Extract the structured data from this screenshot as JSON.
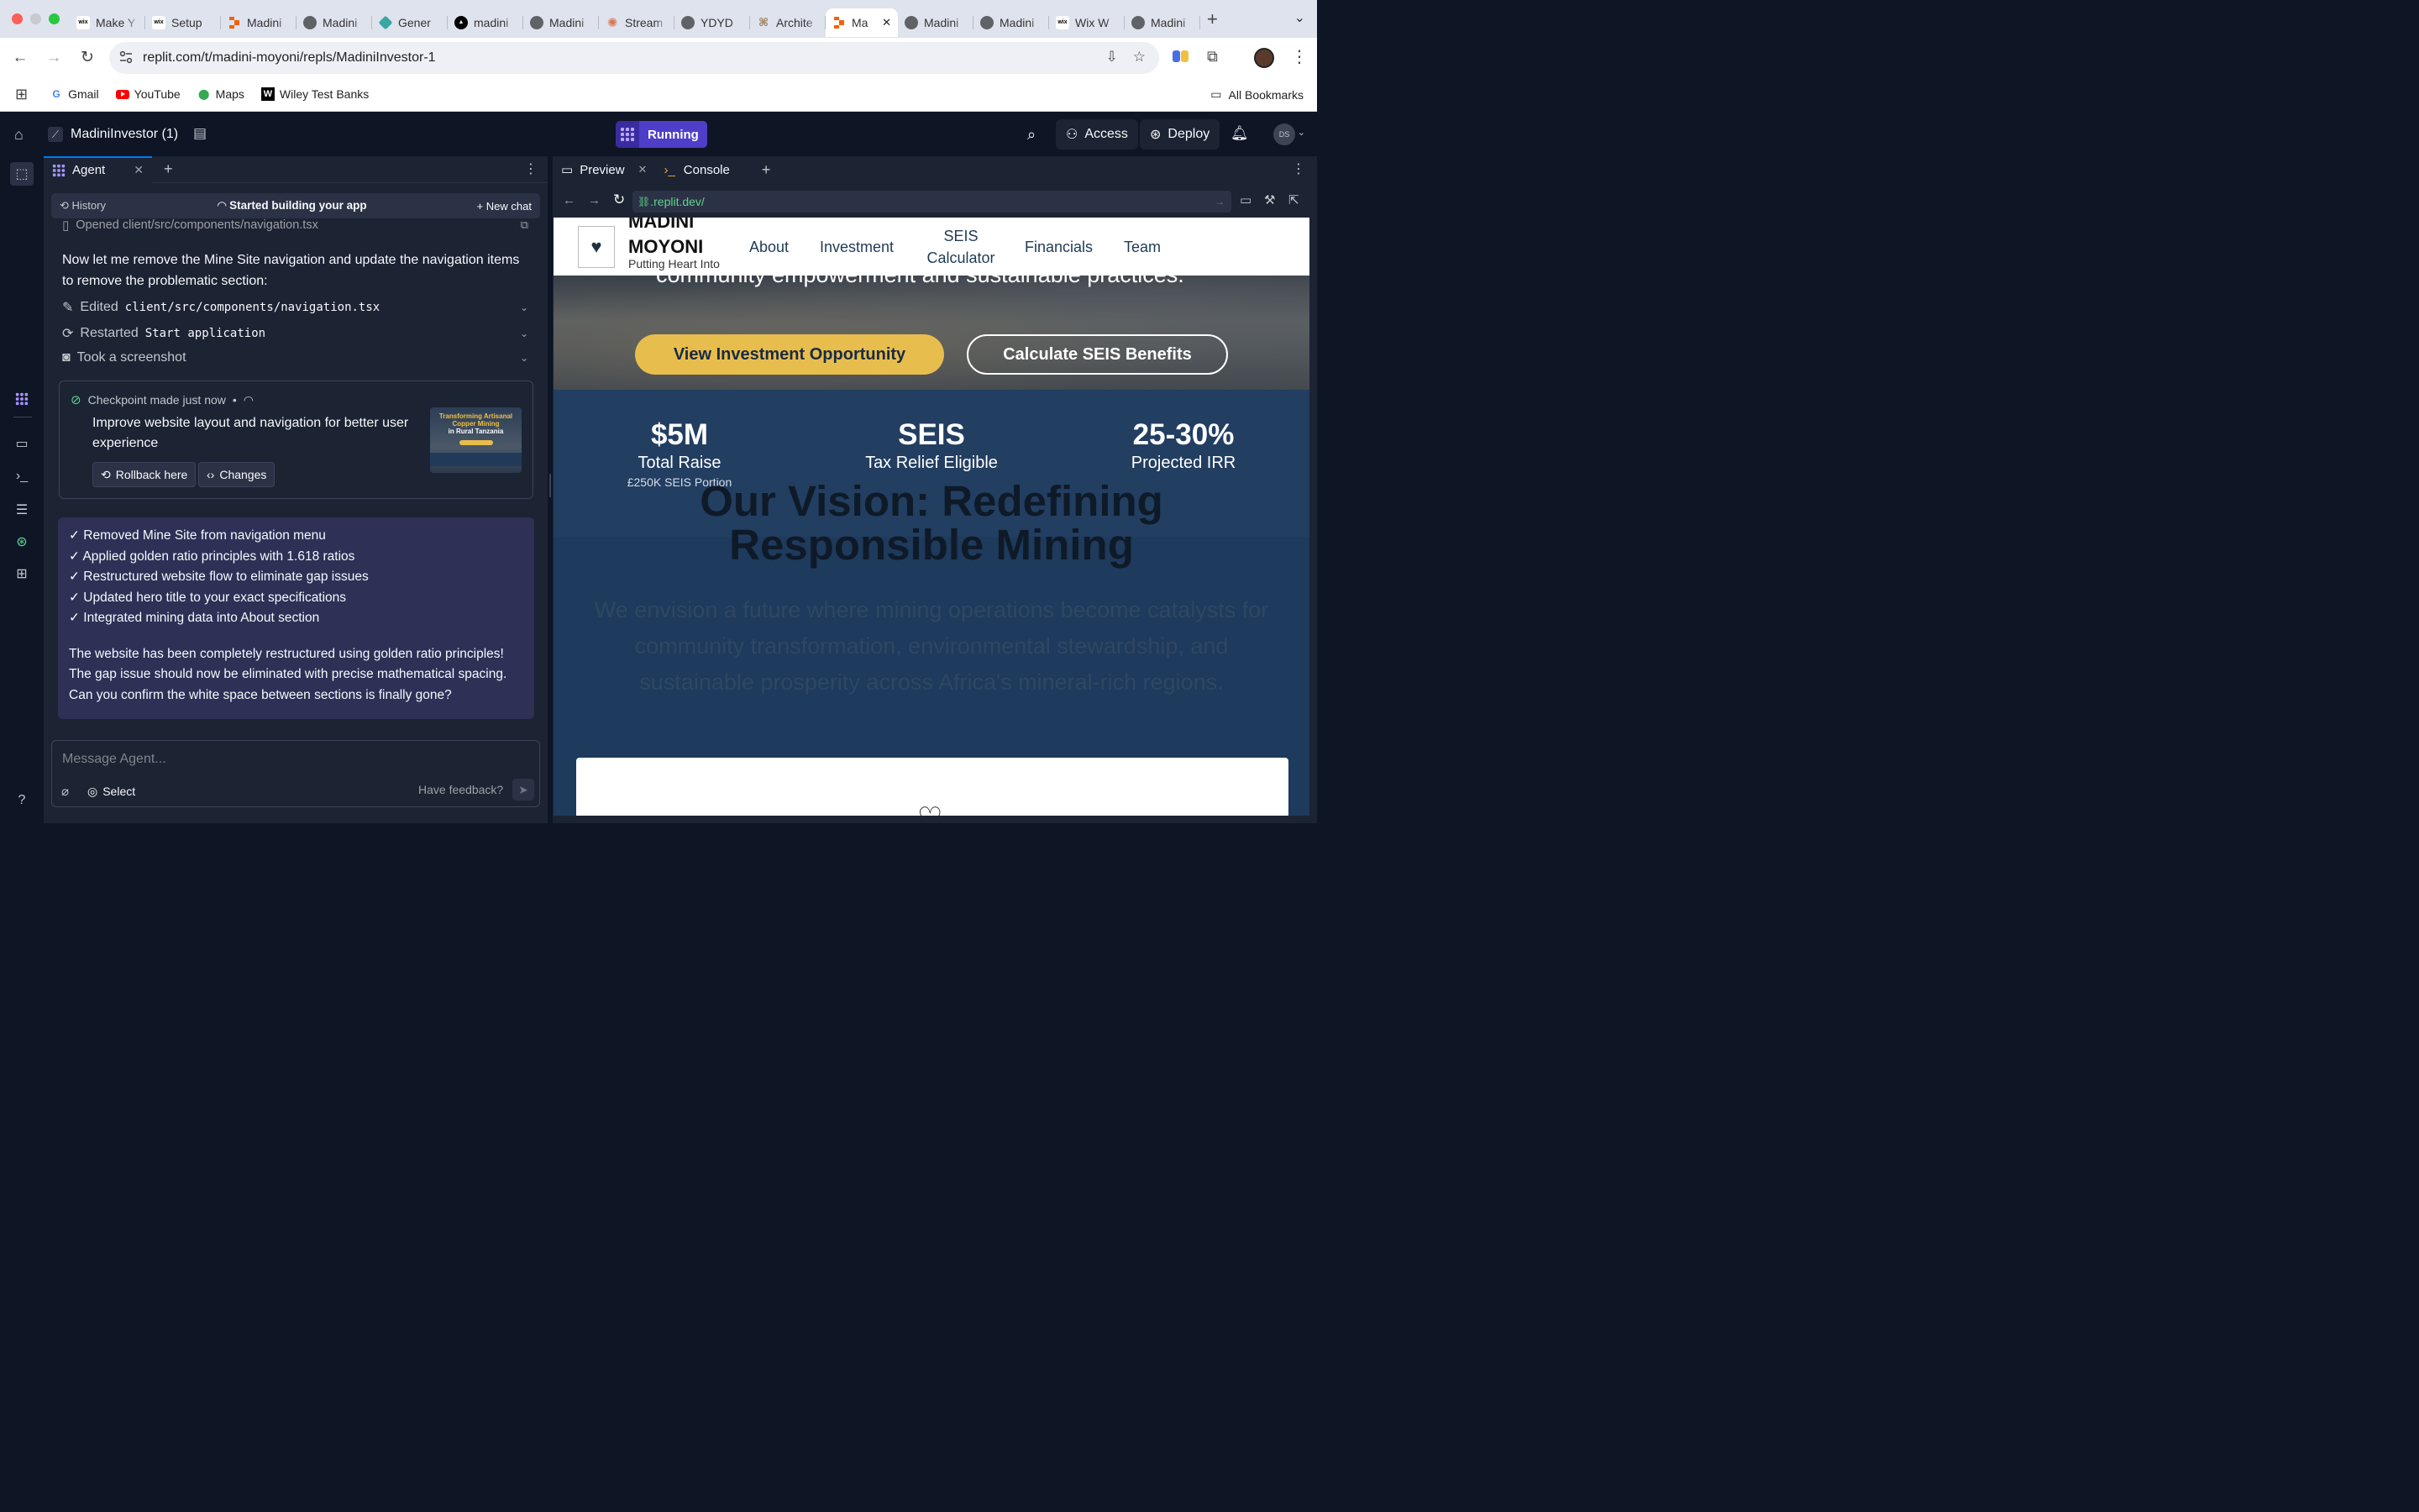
{
  "browser": {
    "tabs": [
      {
        "label": "Make Y",
        "fav": "wix",
        "color": "#000000"
      },
      {
        "label": "Setup",
        "fav": "wix",
        "color": "#000000"
      },
      {
        "label": "Madini",
        "fav": "replit",
        "color": "#f26207"
      },
      {
        "label": "Madini",
        "fav": "globe",
        "color": "#5f6368"
      },
      {
        "label": "Gener",
        "fav": "diamond",
        "color": "#3aa8a0"
      },
      {
        "label": "madini",
        "fav": "triangle",
        "color": "#000000"
      },
      {
        "label": "Madini",
        "fav": "globe",
        "color": "#5f6368"
      },
      {
        "label": "Stream",
        "fav": "claude",
        "color": "#d97757"
      },
      {
        "label": "YDYD",
        "fav": "globe",
        "color": "#5f6368"
      },
      {
        "label": "Archite",
        "fav": "arch",
        "color": "#9a7d55"
      },
      {
        "label": "Ma",
        "fav": "replit",
        "color": "#f26207",
        "active": true
      },
      {
        "label": "Madini",
        "fav": "globe",
        "color": "#5f6368"
      },
      {
        "label": "Madini",
        "fav": "globe",
        "color": "#5f6368"
      },
      {
        "label": "Wix W",
        "fav": "wix",
        "color": "#000000"
      },
      {
        "label": "Madini",
        "fav": "globe",
        "color": "#5f6368"
      }
    ],
    "new_tab": "+",
    "url": "replit.com/t/madini-moyoni/repls/MadiniInvestor-1",
    "bookmarks": [
      "Gmail",
      "YouTube",
      "Maps",
      "Wiley Test Banks"
    ],
    "all_bookmarks": "All Bookmarks"
  },
  "replit": {
    "project_name": "MadiniInvestor (1)",
    "run_status": "Running",
    "access_label": "Access",
    "deploy_label": "Deploy",
    "avatar_initials": "DS",
    "agent_tab": "Agent",
    "history_label": "History",
    "status_title": "Started building your app",
    "new_chat_label": "New chat",
    "opened_file": "Opened client/src/components/navigation.tsx",
    "message_1": "Now let me remove the Mine Site navigation and update the navigation items to remove the problematic section:",
    "actions": [
      {
        "verb": "Edited",
        "target": "client/src/components/navigation.tsx"
      },
      {
        "verb": "Restarted",
        "target": "Start application"
      },
      {
        "verb": "Took a screenshot",
        "target": ""
      }
    ],
    "checkpoint": {
      "label": "Checkpoint made",
      "time": "just now",
      "title": "Improve website layout and navigation for better user experience",
      "rollback_label": "Rollback here",
      "changes_label": "Changes",
      "thumb_title": "Transforming Artisanal Copper Mining",
      "thumb_sub": "in Rural Tanzania"
    },
    "summary_items": [
      "✓ Removed Mine Site from navigation menu",
      "✓ Applied golden ratio principles with 1.618 ratios",
      "✓ Restructured website flow to eliminate gap issues",
      "✓ Updated hero title to your exact specifications",
      "✓ Integrated mining data into About section"
    ],
    "summary_text": "The website has been completely restructured using golden ratio principles! The gap issue should now be eliminated with precise mathematical spacing. Can you confirm the white space between sections is finally gone?",
    "input_placeholder": "Message Agent...",
    "select_label": "Select",
    "feedback_label": "Have feedback?",
    "preview_tab": "Preview",
    "console_tab": "Console",
    "preview_url": ".replit.dev/"
  },
  "site": {
    "brand_line1": "MADINI",
    "brand_line2": "MOYONI",
    "tagline": "Putting Heart Into",
    "nav": [
      "About",
      "Investment",
      "SEIS Calculator",
      "Financials",
      "Team"
    ],
    "hero_tail": "community empowerment and sustainable practices.",
    "cta_primary": "View Investment Opportunity",
    "cta_secondary": "Calculate SEIS Benefits",
    "stats": [
      {
        "value": "$5M",
        "label": "Total Raise",
        "note": "£250K SEIS Portion"
      },
      {
        "value": "SEIS",
        "label": "Tax Relief Eligible",
        "note": ""
      },
      {
        "value": "25-30%",
        "label": "Projected IRR",
        "note": ""
      }
    ],
    "vision_title": "Our Vision: Redefining Responsible Mining",
    "vision_text": "We envision a future where mining operations become catalysts for community transformation, environmental stewardship, and sustainable prosperity across Africa's mineral-rich regions."
  }
}
